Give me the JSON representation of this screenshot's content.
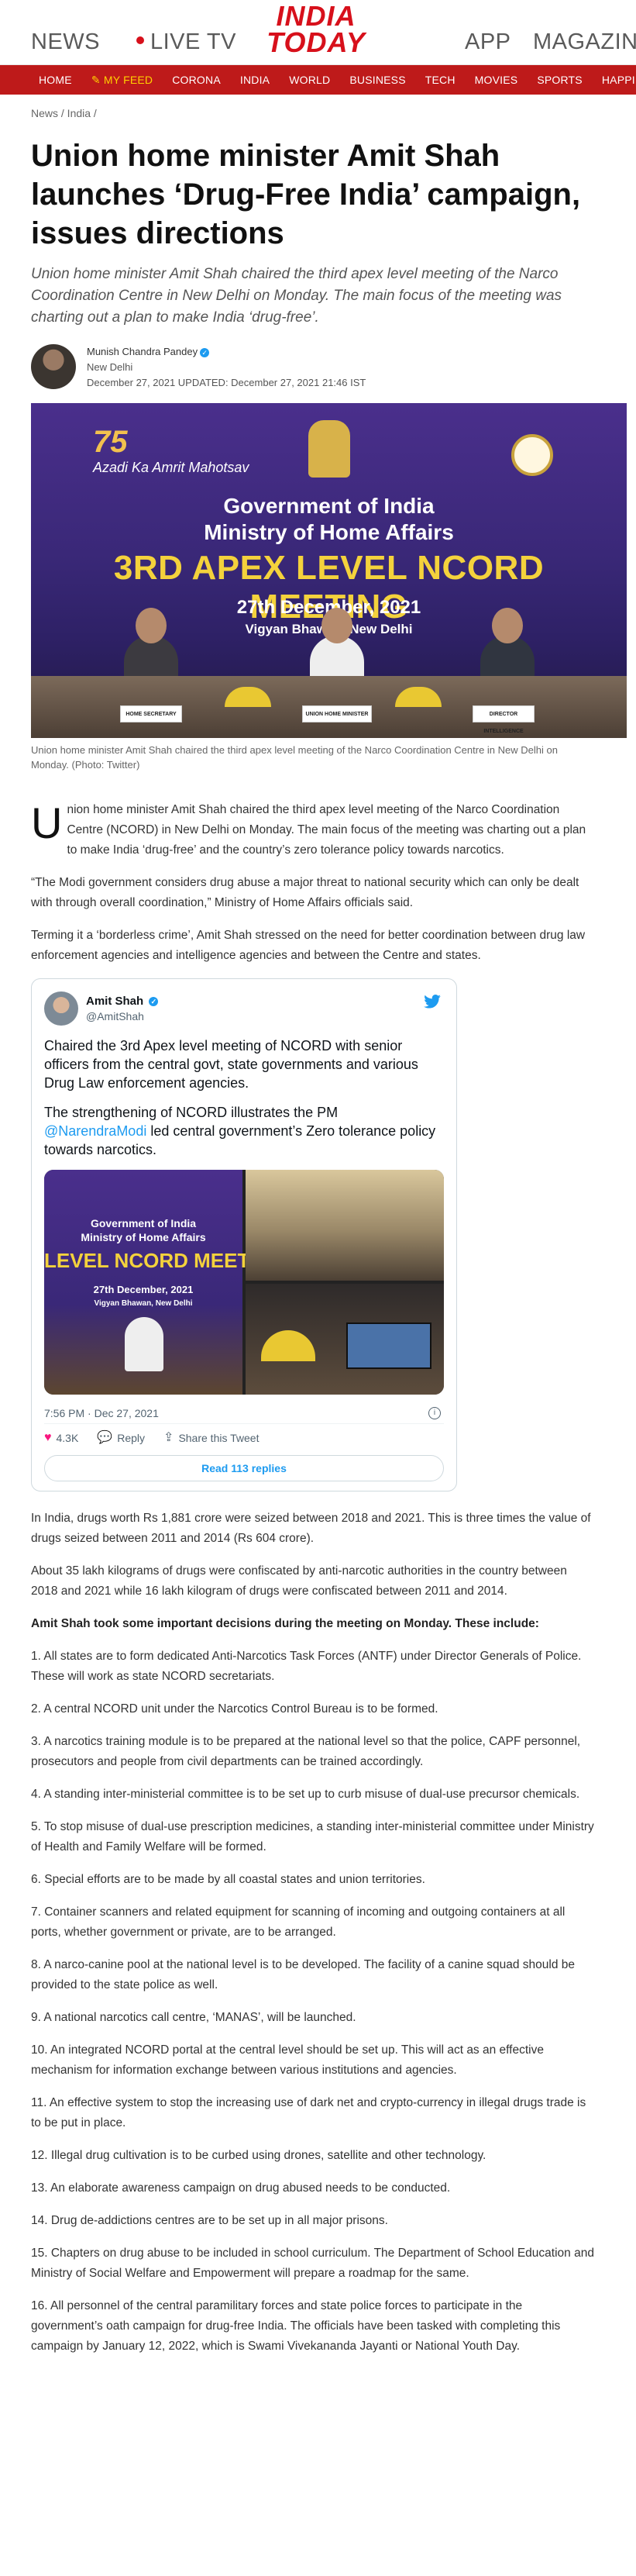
{
  "header": {
    "nav_left": [
      "NEWS",
      "LIVE TV"
    ],
    "logo_line1": "INDIA",
    "logo_line2": "TODAY",
    "nav_right": [
      "APP",
      "MAGAZINE"
    ]
  },
  "section_nav": [
    "HOME",
    "MY FEED",
    "CORONA",
    "INDIA",
    "WORLD",
    "BUSINESS",
    "TECH",
    "MOVIES",
    "SPORTS",
    "HAPPINESS QUEST"
  ],
  "breadcrumb": "News / India /",
  "article": {
    "headline": "Union home minister Amit Shah launches ‘Drug-Free India’ campaign, issues directions",
    "standfirst": "Union home minister Amit Shah chaired the third apex level meeting of the Narco Coordination Centre in New Delhi on Monday. The main focus of the meeting was charting out a plan to make India ‘drug-free’.",
    "author": "Munish Chandra Pandey",
    "location": "New Delhi",
    "dateline": "December 27, 2021   UPDATED: December 27, 2021 21:46 IST"
  },
  "hero": {
    "amrit_75": "75",
    "amrit_text": "Azadi Ka Amrit Mahotsav",
    "gov_line1": "Government of India",
    "gov_line2": "Ministry of Home Affairs",
    "ncord": "3RD APEX LEVEL NCORD MEETING",
    "date": "27th December, 2021",
    "venue": "Vigyan Bhawan, New Delhi",
    "plate1": "HOME SECRETARY",
    "plate2": "UNION HOME MINISTER",
    "plate3": "DIRECTOR INTELLIGENCE BUREAU",
    "caption": "Union home minister Amit Shah chaired the third apex level meeting of the Narco Coordination Centre in New Delhi on Monday. (Photo: Twitter)"
  },
  "body": {
    "dropcap": "U",
    "p1": "nion home minister Amit Shah chaired the third apex level meeting of the Narco Coordination Centre (NCORD) in New Delhi on Monday. The main focus of the meeting was charting out a plan to make India ‘drug-free’ and the country’s zero tolerance policy towards narcotics.",
    "p2": "“The Modi government considers drug abuse a major threat to national security which can only be dealt with through overall coordination,” Ministry of Home Affairs officials said.",
    "p3": "Terming it a ‘borderless crime’, Amit Shah stressed on the need for better coordination between drug law enforcement agencies and intelligence agencies and between the Centre and states.",
    "p4": "In India, drugs worth Rs 1,881 crore were seized between 2018 and 2021. This is three times the value of drugs seized between 2011 and 2014 (Rs 604 crore).",
    "p5": "About 35 lakh kilograms of drugs were confiscated by anti-narcotic authorities in the country between 2018 and 2021 while 16 lakh kilogram of drugs were confiscated between 2011 and 2014.",
    "decisions_intro": "Amit Shah took some important decisions during the meeting on Monday. These include:",
    "decisions": [
      "1. All states are to form dedicated Anti-Narcotics Task Forces (ANTF) under Director Generals of Police. These will work as state NCORD secretariats.",
      "2. A central NCORD unit under the Narcotics Control Bureau is to be formed.",
      "3. A narcotics training module is to be prepared at the national level so that the police, CAPF personnel, prosecutors and people from civil departments can be trained accordingly.",
      "4. A standing inter-ministerial committee is to be set up to curb misuse of dual-use precursor chemicals.",
      "5. To stop misuse of dual-use prescription medicines, a standing inter-ministerial committee under Ministry of Health and Family Welfare will be formed.",
      "6. Special efforts are to be made by all coastal states and union territories.",
      "7. Container scanners and related equipment for scanning of incoming and outgoing containers at all ports, whether government or private, are to be arranged.",
      "8. A narco-canine pool at the national level is to be developed. The facility of a canine squad should be provided to the state police as well.",
      "9. A national narcotics call centre, ‘MANAS’, will be launched.",
      "10. An integrated NCORD portal at the central level should be set up. This will act as an effective mechanism for information exchange between various institutions and agencies.",
      "11. An effective system to stop the increasing use of dark net and crypto-currency in illegal drugs trade is to be put in place.",
      "12. Illegal drug cultivation is to be curbed using drones, satellite and other technology.",
      "13. An elaborate awareness campaign on drug abused needs to be conducted.",
      "14. Drug de-addictions centres are to be set up in all major prisons.",
      "15. Chapters on drug abuse to be included in school curriculum. The Department of School Education and Ministry of Social Welfare and Empowerment will prepare a roadmap for the same.",
      "16. All personnel of the central paramilitary forces and state police forces to participate in the government’s oath campaign for drug-free India. The officials have been tasked with completing this campaign by January 12, 2022, which is Swami Vivekananda Jayanti or National Youth Day."
    ]
  },
  "tweet": {
    "name": "Amit Shah",
    "handle": "@AmitShah",
    "text1": "Chaired the 3rd Apex level meeting of NCORD with senior officers from the central govt, state governments and various Drug Law enforcement agencies.",
    "text2_before": "The strengthening of NCORD illustrates the PM ",
    "text2_link": "@NarendraModi",
    "text2_after": " led central government’s Zero tolerance policy towards narcotics.",
    "media_gov1": "Government of India",
    "media_gov2": "Ministry of Home Affairs",
    "media_title": "LEVEL NCORD MEETI",
    "media_date": "27th December, 2021",
    "media_venue": "Vigyan Bhawan, New Delhi",
    "timestamp": "7:56 PM · Dec 27, 2021",
    "likes": "4.3K",
    "reply_label": "Reply",
    "share_label": "Share this Tweet",
    "read_replies": "Read 113 replies"
  },
  "colors": {
    "brand_red": "#d7101b",
    "nav_red": "#be1a1a",
    "feed_yellow": "#ffd000",
    "twitter_blue": "#1d9bf0"
  }
}
